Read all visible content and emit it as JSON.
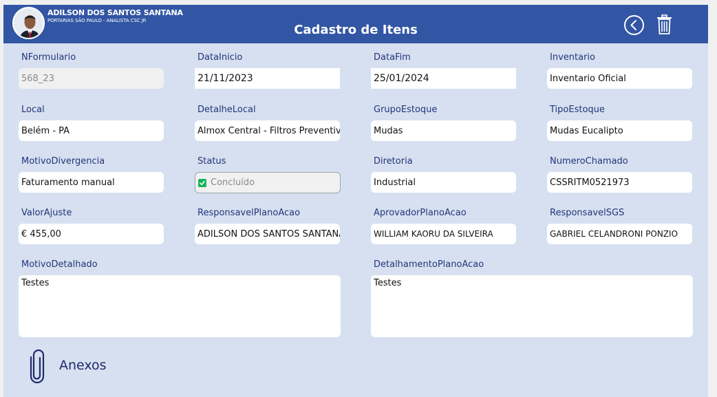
{
  "header": {
    "user_name": "ADILSON DOS SANTOS SANTANA",
    "user_role": "PORTARIAS SÃO PAULO - ANALISTA CSC JR",
    "title": "Cadastro de Itens",
    "back_icon": "chevron-left-circle-icon",
    "delete_icon": "trash-icon"
  },
  "form": {
    "n_formulario": {
      "label": "NFormulario",
      "value": "568_23"
    },
    "data_inicio": {
      "label": "DataInicio",
      "value": "21/11/2023"
    },
    "data_fim": {
      "label": "DataFim",
      "value": "25/01/2024"
    },
    "inventario": {
      "label": "Inventario",
      "value": "Inventario Oficial"
    },
    "local": {
      "label": "Local",
      "value": "Belém - PA"
    },
    "detalhe_local": {
      "label": "DetalheLocal",
      "value": "Almox Central - Filtros Preventiva"
    },
    "grupo_estoque": {
      "label": "GrupoEstoque",
      "value": "Mudas"
    },
    "tipo_estoque": {
      "label": "TipoEstoque",
      "value": "Mudas Eucalipto"
    },
    "motivo_divergencia": {
      "label": "MotivoDivergencia",
      "value": "Faturamento manual"
    },
    "status": {
      "label": "Status",
      "value": "Concluído",
      "checked": true
    },
    "diretoria": {
      "label": "Diretoria",
      "value": "Industrial"
    },
    "numero_chamado": {
      "label": "NumeroChamado",
      "value": "CSSRITM0521973"
    },
    "valor_ajuste": {
      "label": "ValorAjuste",
      "value": "€ 455,00"
    },
    "responsavel_plano_acao": {
      "label": "ResponsavelPlanoAcao",
      "value": "ADILSON DOS SANTOS SANTANA"
    },
    "aprovador_plano_acao": {
      "label": "AprovadorPlanoAcao",
      "value": "WILLIAM KAORU DA SILVEIRA"
    },
    "responsavel_sgs": {
      "label": "ResponsavelSGS",
      "value": "GABRIEL CELANDRONI PONZIO"
    },
    "motivo_detalhado": {
      "label": "MotivoDetalhado",
      "value": "Testes"
    },
    "detalhamento_plano_acao": {
      "label": "DetalhamentoPlanoAcao",
      "value": "Testes"
    }
  },
  "attachments": {
    "label": "Anexos",
    "icon": "paperclip-icon"
  },
  "colors": {
    "header_bg": "#3256a4",
    "page_bg": "#d6e0f0",
    "label_text": "#23357a",
    "status_check": "#16b35b"
  }
}
